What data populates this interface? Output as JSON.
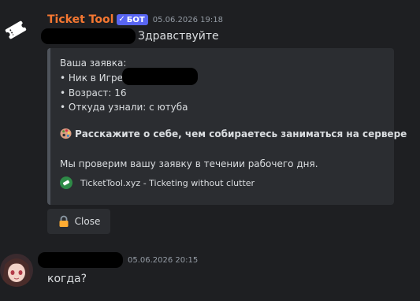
{
  "bot_message": {
    "author": "Ticket Tool",
    "badge": "БОТ",
    "badge_check": "✓",
    "timestamp": "05.06.2026 19:18",
    "greeting": "Здравствуйте",
    "embed": {
      "line1": "Ваша заявка:",
      "line2": "• Ник в Игре:",
      "line3": "• Возраст: 16",
      "line4": "• Откуда узнали: с ютуба",
      "question": "Расскажите о себе, чем собираетесь заниматься на сервере",
      "note": "Мы проверим вашу заявку в течении рабочего дня.",
      "footer": "TicketTool.xyz - Ticketing without clutter"
    },
    "button_close": "Close"
  },
  "user_message": {
    "timestamp": "05.06.2026 20:15",
    "text": "когда?"
  },
  "colors": {
    "background": "#1e1f22",
    "bot_name": "#f57731",
    "badge": "#5865f2",
    "embed_bg": "#2b2d31",
    "embed_border": "#4f545c",
    "timestamp": "#949ba4"
  }
}
